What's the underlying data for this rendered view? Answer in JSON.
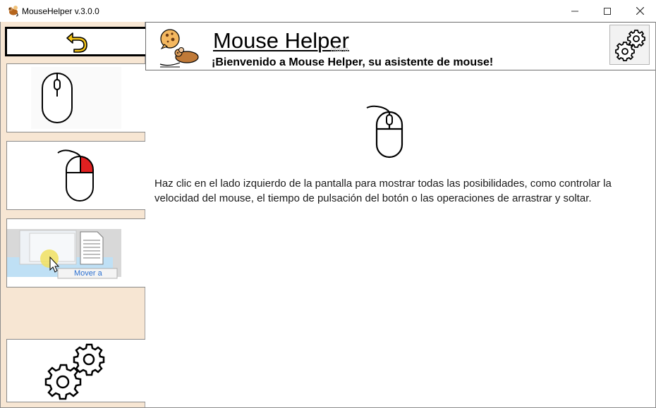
{
  "window": {
    "title": "MouseHelper v.3.0.0",
    "controls": {
      "minimize": "minimize",
      "maximize": "maximize",
      "close": "close"
    }
  },
  "sidebar": {
    "items": [
      {
        "name": "back",
        "icon": "undo-arrow-icon"
      },
      {
        "name": "mouse-basic",
        "icon": "mouse-icon"
      },
      {
        "name": "right-click",
        "icon": "mouse-right-button-icon"
      },
      {
        "name": "drag-and-drop",
        "icon": "drag-drop-icon",
        "label": "Mover a"
      },
      {
        "name": "settings",
        "icon": "gears-icon"
      }
    ]
  },
  "header": {
    "title": "Mouse Helper",
    "subtitle": "¡Bienvenido a Mouse Helper, su asistente de mouse!",
    "watermark": "ntana"
  },
  "main": {
    "description": "Haz clic en el lado izquierdo de la pantalla para mostrar todas las posibilidades, como controlar la velocidad del mouse, el tiempo de pulsación del botón o las operaciones de arrastrar y soltar."
  },
  "colors": {
    "sidebar_bg": "#f7e6d3",
    "accent_yellow": "#f5c518",
    "right_button_red": "#e02020",
    "mouse_brown": "#b5651d"
  }
}
